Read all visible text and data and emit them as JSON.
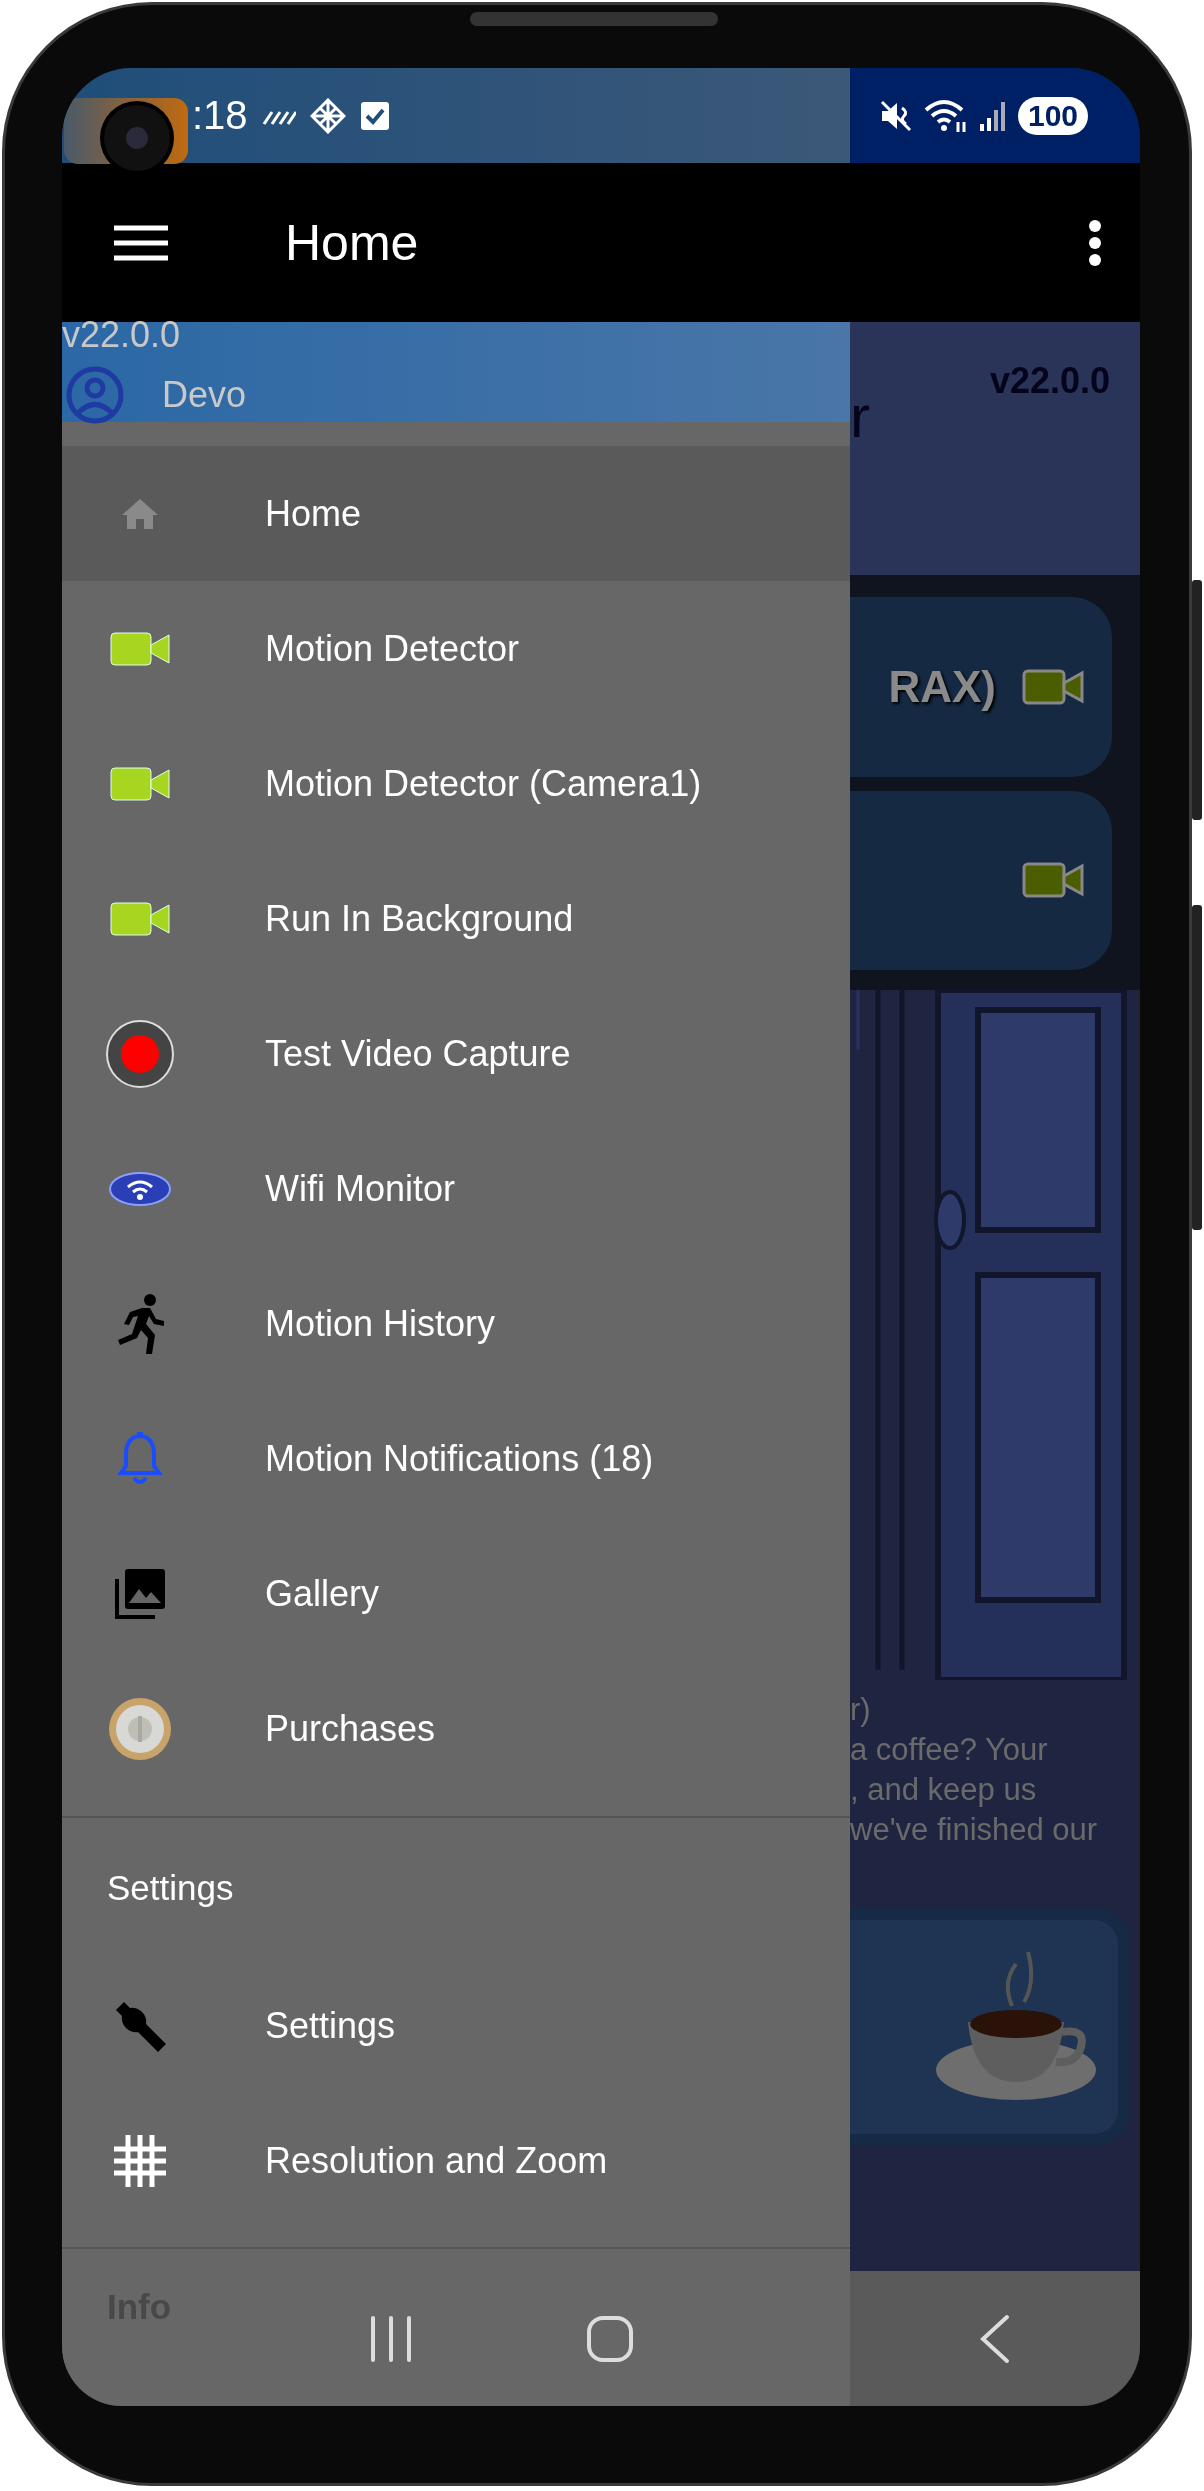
{
  "status_bar": {
    "time": ":18",
    "battery": "100"
  },
  "app_bar": {
    "title": "Home"
  },
  "drawer": {
    "version": "v22.0.0",
    "user": "Devo",
    "items": [
      {
        "label": "Home",
        "kind": "home",
        "selected": true
      },
      {
        "label": "Motion Detector",
        "kind": "video",
        "selected": false
      },
      {
        "label": "Motion Detector (Camera1)",
        "kind": "video",
        "selected": false
      },
      {
        "label": "Run In Background",
        "kind": "video",
        "selected": false
      },
      {
        "label": "Test Video Capture",
        "kind": "record",
        "selected": false
      },
      {
        "label": "Wifi Monitor",
        "kind": "wifi",
        "selected": false
      },
      {
        "label": "Motion History",
        "kind": "runner",
        "selected": false
      },
      {
        "label": "Motion Notifications (18)",
        "kind": "bell",
        "selected": false
      },
      {
        "label": "Gallery",
        "kind": "gallery",
        "selected": false
      },
      {
        "label": "Purchases",
        "kind": "coin",
        "selected": false
      }
    ],
    "sections": [
      {
        "title": "Settings",
        "items": [
          {
            "label": "Settings",
            "kind": "wrench",
            "selected": false
          },
          {
            "label": "Resolution and Zoom",
            "kind": "grid",
            "selected": false
          }
        ]
      },
      {
        "title": "Info"
      }
    ]
  },
  "background": {
    "version": "v22.0.0",
    "heading_fragment": "r",
    "cards": [
      {
        "title": "RAX)",
        "kind": "video"
      },
      {
        "kind": "video"
      }
    ],
    "message_lines": [
      "r)",
      "a coffee? Your",
      ", and keep us",
      "we've finished our"
    ]
  }
}
